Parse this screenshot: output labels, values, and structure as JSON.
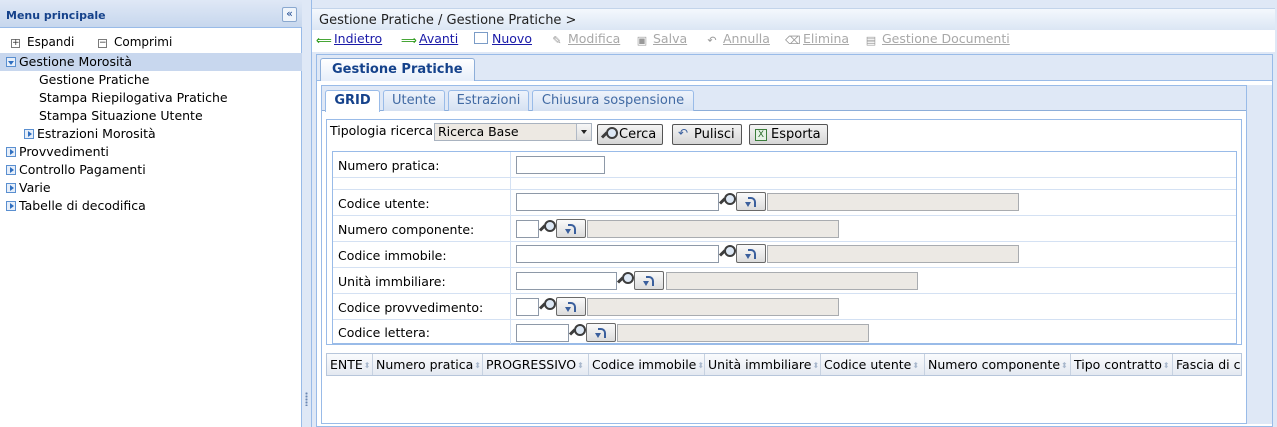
{
  "sidebar": {
    "title": "Menu principale",
    "collapse_glyph": "«",
    "expand_label": "Espandi",
    "collapse_label": "Comprimi",
    "items": [
      {
        "label": "Gestione Morosità",
        "level": 0,
        "state": "expanded",
        "selected": true
      },
      {
        "label": "Gestione Pratiche",
        "level": 2
      },
      {
        "label": "Stampa Riepilogativa Pratiche",
        "level": 2
      },
      {
        "label": "Stampa Situazione Utente",
        "level": 2
      },
      {
        "label": "Estrazioni Morosità",
        "level": 1,
        "state": "collapsed"
      },
      {
        "label": "Provvedimenti",
        "level": 0,
        "state": "collapsed"
      },
      {
        "label": "Controllo Pagamenti",
        "level": 0,
        "state": "collapsed"
      },
      {
        "label": "Varie",
        "level": 0,
        "state": "collapsed"
      },
      {
        "label": "Tabelle di decodifica",
        "level": 0,
        "state": "collapsed"
      }
    ]
  },
  "breadcrumb": "Gestione Pratiche / Gestione Pratiche >",
  "actions": [
    {
      "label": "Indietro",
      "icon": "arrow-left-icon",
      "enabled": true
    },
    {
      "label": "Avanti",
      "icon": "arrow-right-icon",
      "enabled": true
    },
    {
      "label": "Nuovo",
      "icon": "new-document-icon",
      "enabled": true
    },
    {
      "label": "Modifica",
      "icon": "edit-icon",
      "enabled": false
    },
    {
      "label": "Salva",
      "icon": "save-icon",
      "enabled": false
    },
    {
      "label": "Annulla",
      "icon": "undo-icon",
      "enabled": false
    },
    {
      "label": "Elimina",
      "icon": "delete-icon",
      "enabled": false
    },
    {
      "label": "Gestione Documenti",
      "icon": "documents-icon",
      "enabled": false
    }
  ],
  "main_tab": "Gestione Pratiche",
  "inner_tabs": [
    {
      "label": "GRID",
      "active": true
    },
    {
      "label": "Utente",
      "active": false
    },
    {
      "label": "Estrazioni",
      "active": false
    },
    {
      "label": "Chiusura sospensione",
      "active": false
    }
  ],
  "search": {
    "tipologia_label": "Tipologia ricerca",
    "tipologia_value": "Ricerca Base",
    "cerca_label": "Cerca",
    "pulisci_label": "Pulisci",
    "esporta_label": "Esporta"
  },
  "form_fields": [
    {
      "label": "Numero pratica:",
      "value": ""
    },
    {
      "label": "Codice utente:",
      "value": ""
    },
    {
      "label": "Numero componente:",
      "value": ""
    },
    {
      "label": "Codice immobile:",
      "value": ""
    },
    {
      "label": "Unità immbiliare:",
      "value": ""
    },
    {
      "label": "Codice provvedimento:",
      "value": ""
    },
    {
      "label": "Codice lettera:",
      "value": ""
    }
  ],
  "grid_columns": [
    "ENTE",
    "Numero pratica",
    "PROGRESSIVO",
    "Codice immobile",
    "Unità immbiliare",
    "Codice utente",
    "Numero componente",
    "Tipo contratto",
    "Fascia di ca"
  ],
  "colors": {
    "accent": "#15428b",
    "link": "#1a1aa8",
    "disabled": "#a8a8a8",
    "border": "#99bbe8",
    "panel_bg": "#dfe8f6"
  }
}
